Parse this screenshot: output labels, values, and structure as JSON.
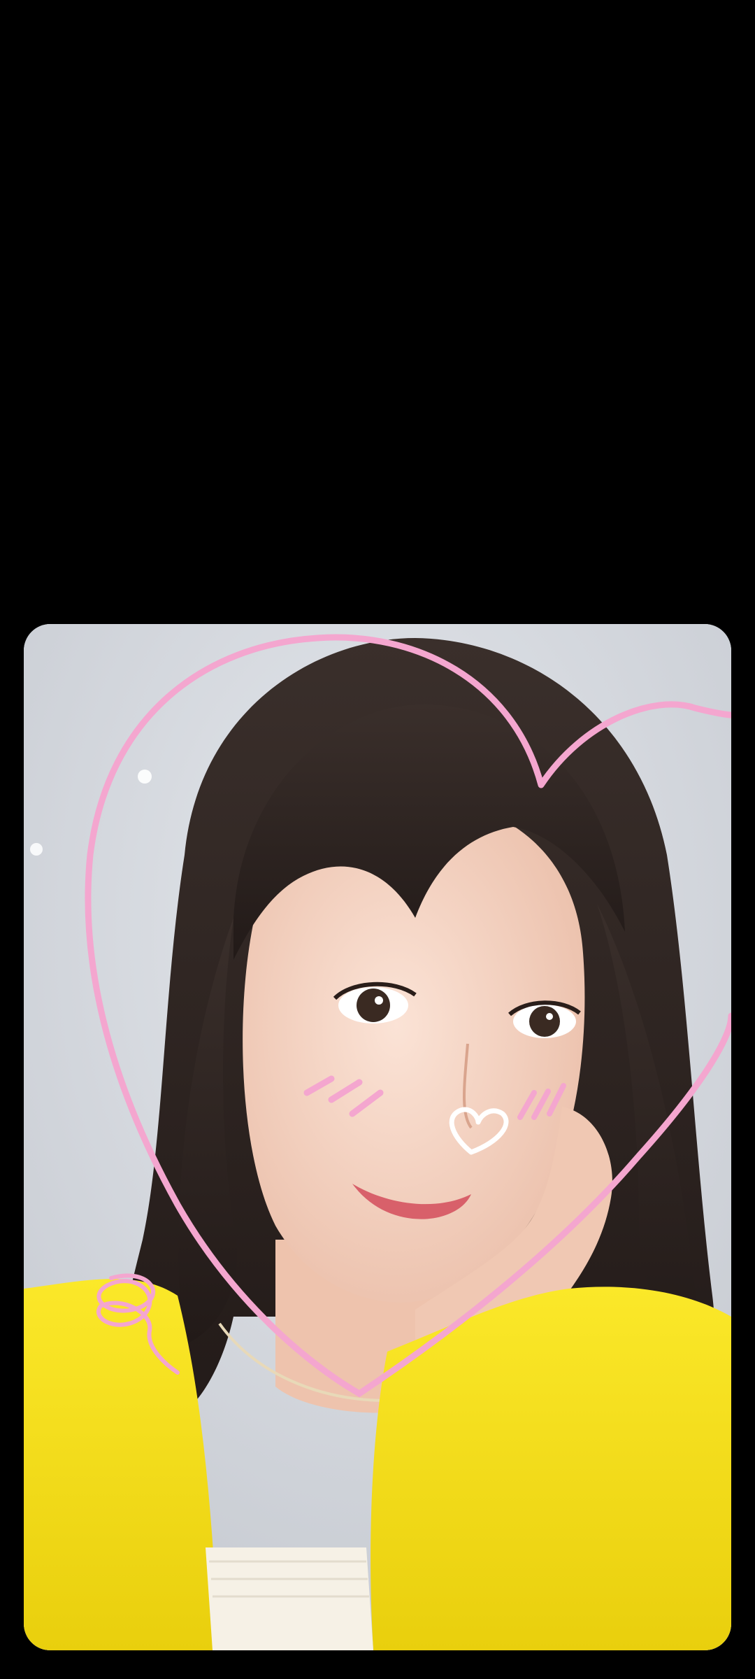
{
  "viewer": {
    "background_color": "#000000",
    "photo": {
      "subject": "selfie-portrait",
      "doodles": [
        "pink-heart-outline",
        "white-nose-heart",
        "pink-blush-marks",
        "pink-swirl"
      ],
      "colors": {
        "backdrop": "#d3d7dd",
        "hair": "#2e2522",
        "skin": "#f3d3c2",
        "sweater": "#f5e21a",
        "top": "#f6f1e6",
        "doodle_pink": "#f4a6cf",
        "doodle_white": "#ffffff"
      }
    }
  }
}
